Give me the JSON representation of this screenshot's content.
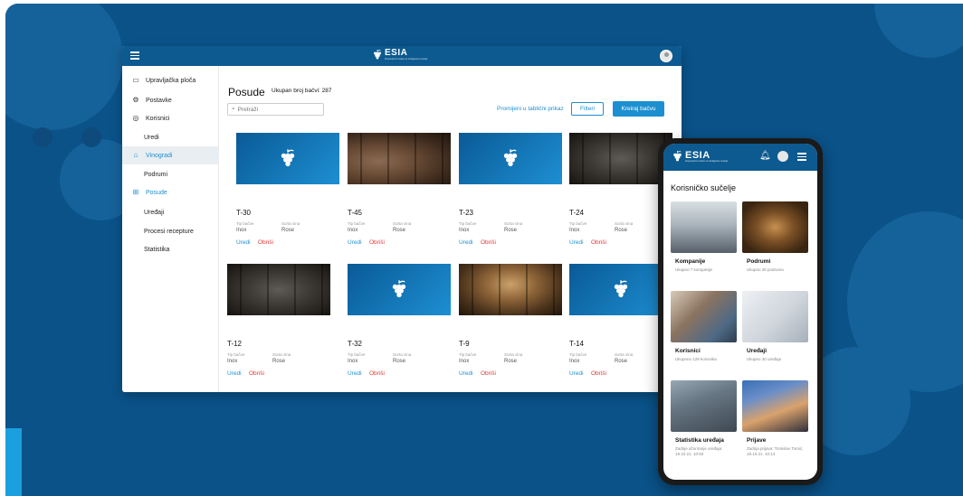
{
  "app": {
    "brand": "ESIA",
    "brand_sub": "Kooperativni sustav za inteligentnu vinariju"
  },
  "colors": {
    "primary": "#0c5a8f",
    "accent": "#1c8fd0",
    "danger": "#e03a3a",
    "background": "#0a5288"
  },
  "sidebar": {
    "items": [
      {
        "label": "Upravljačka ploča",
        "icon": "monitor-icon"
      },
      {
        "label": "Postavke",
        "icon": "gear-icon"
      },
      {
        "label": "Korisnici",
        "icon": "eye-icon"
      },
      {
        "label": "Uredi",
        "icon": ""
      },
      {
        "label": "Vinogradi",
        "icon": "vineyard-icon"
      },
      {
        "label": "Podrumi",
        "icon": ""
      },
      {
        "label": "Posude",
        "icon": "barrel-icon"
      },
      {
        "label": "Uređaji",
        "icon": ""
      },
      {
        "label": "Procesi recepture",
        "icon": ""
      },
      {
        "label": "Statistika",
        "icon": ""
      }
    ]
  },
  "main": {
    "title": "Posude",
    "count_label": "Ukupan broj bačvi: 287",
    "search_placeholder": "Pretraži",
    "table_view_link": "Promijeni u tablični prikaz",
    "filter_button": "Filteri",
    "create_button": "Kreiraj bačvu",
    "cards": [
      {
        "name": "T-30",
        "type_label": "Tip bačve",
        "type_value": "Inox",
        "variety_label": "Sorta vina",
        "variety_value": "Rose",
        "edit": "Uredi",
        "delete": "Obriši"
      },
      {
        "name": "T-45",
        "type_label": "Tip bačve",
        "type_value": "Inox",
        "variety_label": "Sorta vina",
        "variety_value": "Rose",
        "edit": "Uredi",
        "delete": "Obriši"
      },
      {
        "name": "T-23",
        "type_label": "Tip bačve",
        "type_value": "Inox",
        "variety_label": "Sorta vina",
        "variety_value": "Rose",
        "edit": "Uredi",
        "delete": "Obriši"
      },
      {
        "name": "T-24",
        "type_label": "Tip bačve",
        "type_value": "Inox",
        "variety_label": "Sorta vina",
        "variety_value": "Rose",
        "edit": "Uredi",
        "delete": "Obriši"
      },
      {
        "name": "T-12",
        "type_label": "Tip bačve",
        "type_value": "Inox",
        "variety_label": "Sorta vina",
        "variety_value": "Rose",
        "edit": "Uredi",
        "delete": "Obriši"
      },
      {
        "name": "T-32",
        "type_label": "Tip bačve",
        "type_value": "Inox",
        "variety_label": "Sorta vina",
        "variety_value": "Rose",
        "edit": "Uredi",
        "delete": "Obriši"
      },
      {
        "name": "T-9",
        "type_label": "Tip bačve",
        "type_value": "Inox",
        "variety_label": "Sorta vina",
        "variety_value": "Rose",
        "edit": "Uredi",
        "delete": "Obriši"
      },
      {
        "name": "T-14",
        "type_label": "Tip bačve",
        "type_value": "Inox",
        "variety_label": "Sorta vina",
        "variety_value": "Rose",
        "edit": "Uredi",
        "delete": "Obriši"
      }
    ]
  },
  "mobile": {
    "title": "Korisničko sučelje",
    "cards": [
      {
        "title": "Kompanije",
        "subtitle": "Ukupno 7 kompanije"
      },
      {
        "title": "Podrumi",
        "subtitle": "Ukupno 30 podruma"
      },
      {
        "title": "Korisnici",
        "subtitle": "Ukupnno 129 korisnika"
      },
      {
        "title": "Uređaji",
        "subtitle": "Ukupno 30 uređaja"
      },
      {
        "title": "Statistika uređaja",
        "subtitle": "Zadnje ažuriranje uređaja: 19.10.21. 10:50"
      },
      {
        "title": "Prijave",
        "subtitle": "Zadnja prijava: Tomislav Tomić, 19.10.21. 10:14"
      }
    ]
  }
}
